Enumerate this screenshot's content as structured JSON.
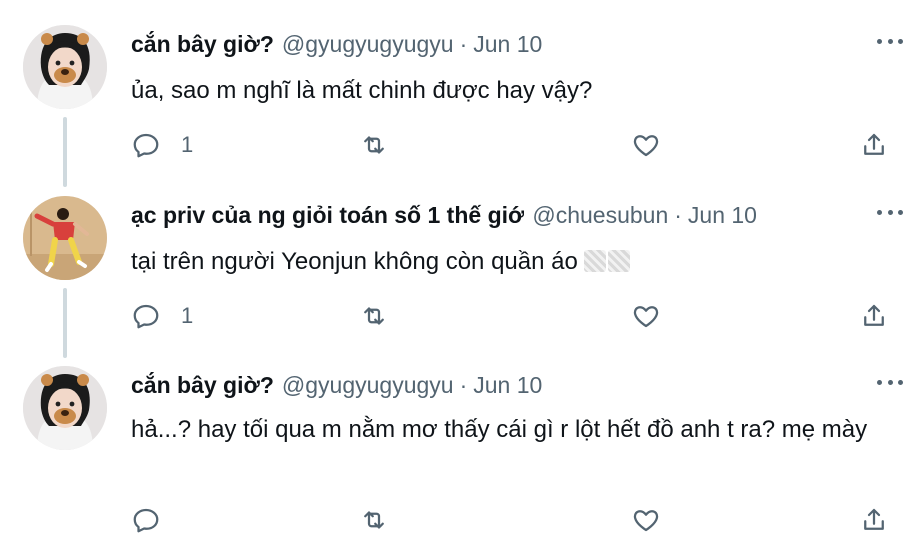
{
  "tweets": [
    {
      "name": "cắn bây giờ?",
      "handle": "@gyugyugyugyu",
      "dot": "·",
      "date": "Jun 10",
      "text": "ủa, sao m nghĩ là mất chinh được hay vậy?",
      "reply_count": "1",
      "avatar_icon": "girl-with-bear-filter-avatar"
    },
    {
      "name": "ạc priv của ng giỏi toán số 1 thế giớ",
      "handle": "@chuesubun",
      "dot": "·",
      "date": "Jun 10",
      "text": "tại trên người Yeonjun không còn quần áo",
      "reply_count": "1",
      "avatar_icon": "dancing-man-avatar"
    },
    {
      "name": "cắn bây giờ?",
      "handle": "@gyugyugyugyu",
      "dot": "·",
      "date": "Jun 10",
      "text": "hả...? hay tối qua m nằm mơ thấy cái gì r lột hết đồ anh t ra? mẹ mày",
      "reply_count": "",
      "avatar_icon": "girl-with-bear-filter-avatar"
    }
  ],
  "colors": {
    "text": "#0f1419",
    "secondary": "#536471",
    "thread_line": "#cfd9de"
  }
}
